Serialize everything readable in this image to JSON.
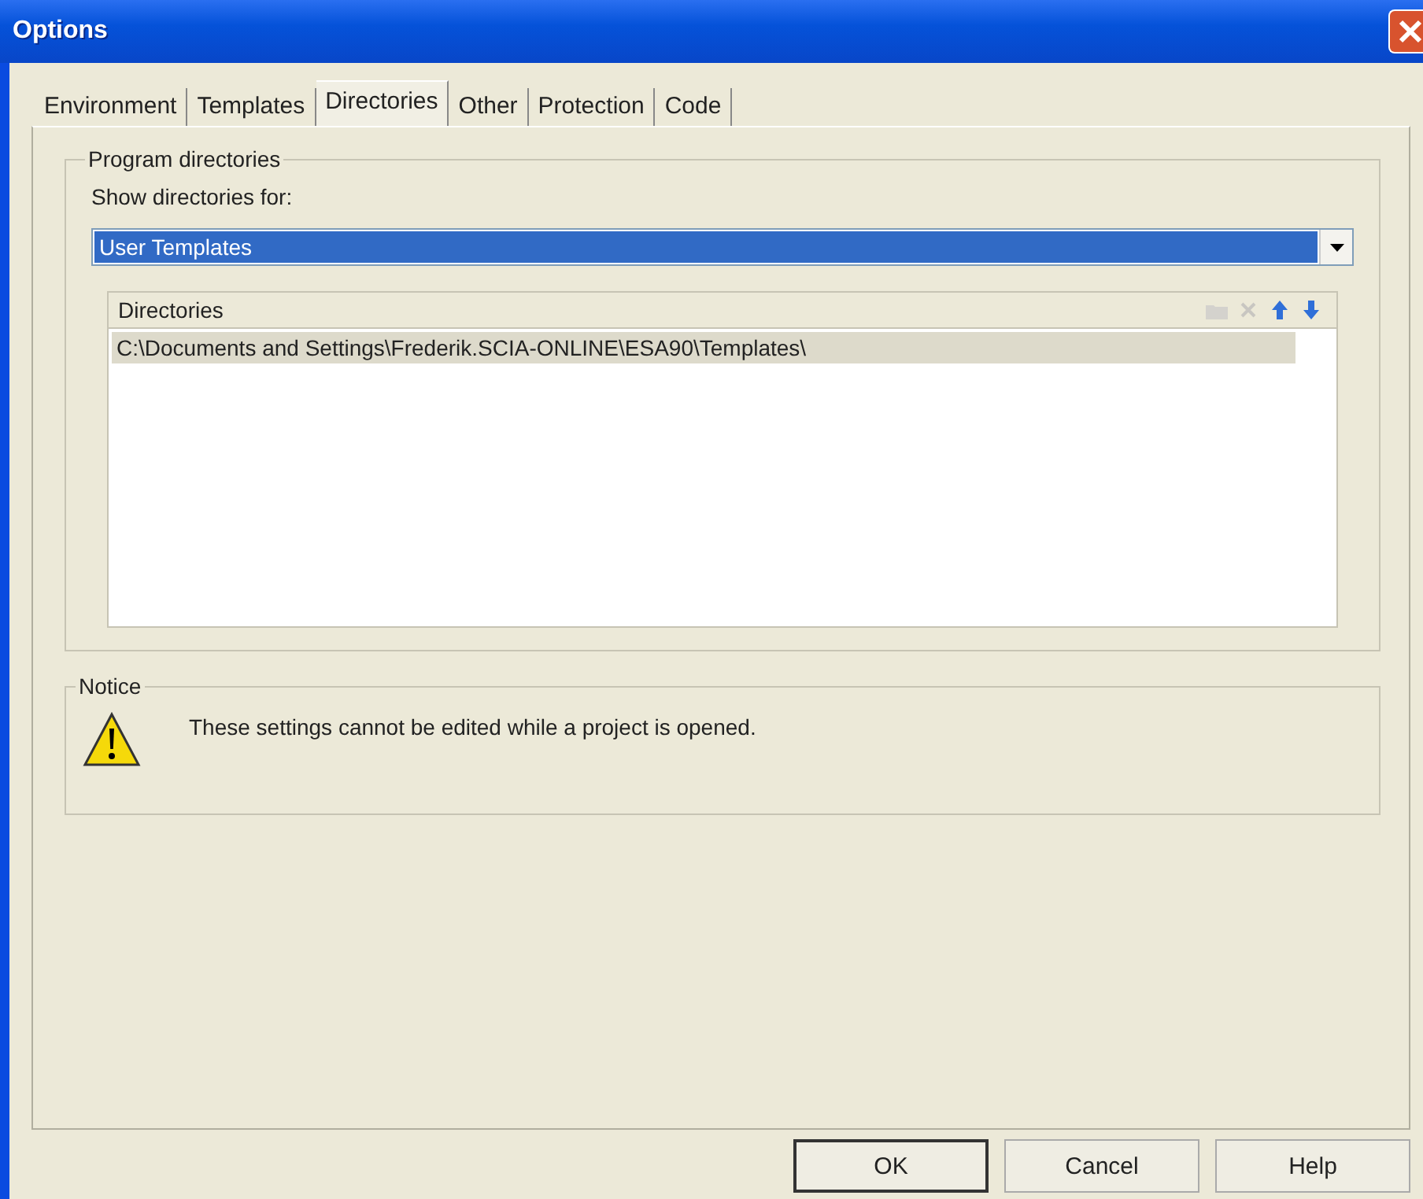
{
  "window": {
    "title": "Options"
  },
  "tabs": [
    {
      "label": "Environment",
      "selected": false
    },
    {
      "label": "Templates",
      "selected": false
    },
    {
      "label": "Directories",
      "selected": true
    },
    {
      "label": "Other",
      "selected": false
    },
    {
      "label": "Protection",
      "selected": false
    },
    {
      "label": "Code",
      "selected": false
    }
  ],
  "program_directories": {
    "title": "Program directories",
    "show_label": "Show directories for:",
    "dropdown_value": "User Templates",
    "list": {
      "header": "Directories",
      "tools": [
        {
          "kind": "folder",
          "disabled": true
        },
        {
          "kind": "delete",
          "disabled": true
        },
        {
          "kind": "up",
          "disabled": false
        },
        {
          "kind": "down",
          "disabled": false
        }
      ],
      "rows": [
        {
          "text": "C:\\Documents and Settings\\Frederik.SCIA-ONLINE\\ESA90\\Templates\\",
          "selected": true
        }
      ]
    }
  },
  "notice": {
    "title": "Notice",
    "message": "These settings cannot be edited while a project is opened."
  },
  "buttons": [
    {
      "label": "OK",
      "default": true
    },
    {
      "label": "Cancel",
      "default": false
    },
    {
      "label": "Help",
      "default": false
    }
  ]
}
